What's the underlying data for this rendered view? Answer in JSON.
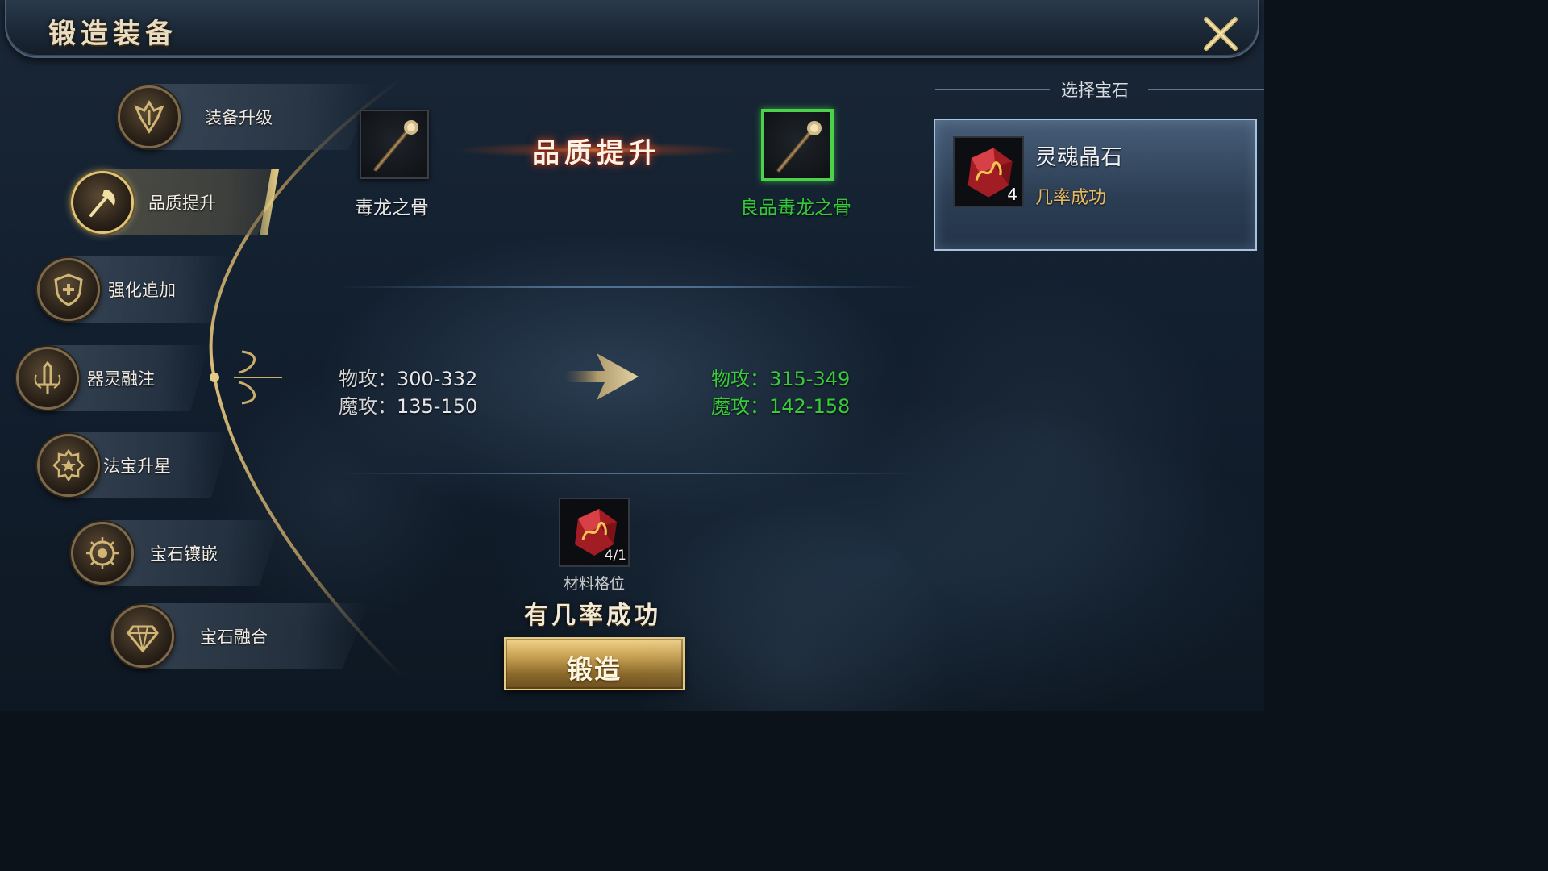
{
  "window": {
    "title": "锻造装备",
    "close_icon": "close-x-icon"
  },
  "sidebar": {
    "items": [
      {
        "label": "装备升级",
        "icon": "wings-crest-icon",
        "active": false
      },
      {
        "label": "品质提升",
        "icon": "axe-icon",
        "active": true
      },
      {
        "label": "强化追加",
        "icon": "shield-plus-icon",
        "active": false
      },
      {
        "label": "器灵融注",
        "icon": "sword-icon",
        "active": false
      },
      {
        "label": "法宝升星",
        "icon": "star-badge-icon",
        "active": false
      },
      {
        "label": "宝石镶嵌",
        "icon": "gem-socket-icon",
        "active": false
      },
      {
        "label": "宝石融合",
        "icon": "diamond-icon",
        "active": false
      }
    ]
  },
  "upgrade": {
    "banner": "品质提升",
    "source_item": {
      "name": "毒龙之骨",
      "icon": "staff-icon"
    },
    "result_item": {
      "name": "良品毒龙之骨",
      "icon": "staff-icon"
    },
    "source_stats": [
      {
        "label": "物攻：",
        "value": "300-332"
      },
      {
        "label": "魔攻：",
        "value": "135-150"
      }
    ],
    "result_stats": [
      {
        "label": "物攻：",
        "value": "315-349"
      },
      {
        "label": "魔攻：",
        "value": "142-158"
      }
    ],
    "arrow_icon": "arrow-right-icon"
  },
  "material": {
    "count": "4/1",
    "label": "材料格位",
    "icon": "red-soul-crystal-icon"
  },
  "forge": {
    "chance_text": "有几率成功",
    "button_label": "锻造"
  },
  "gem_panel": {
    "header": "选择宝石",
    "gem": {
      "name": "灵魂晶石",
      "quantity": "4",
      "description": "几率成功",
      "icon": "red-soul-crystal-icon"
    }
  },
  "colors": {
    "accent_gold": "#e0c477",
    "success_green": "#38cc3a",
    "gem_desc_orange": "#e5b864"
  }
}
